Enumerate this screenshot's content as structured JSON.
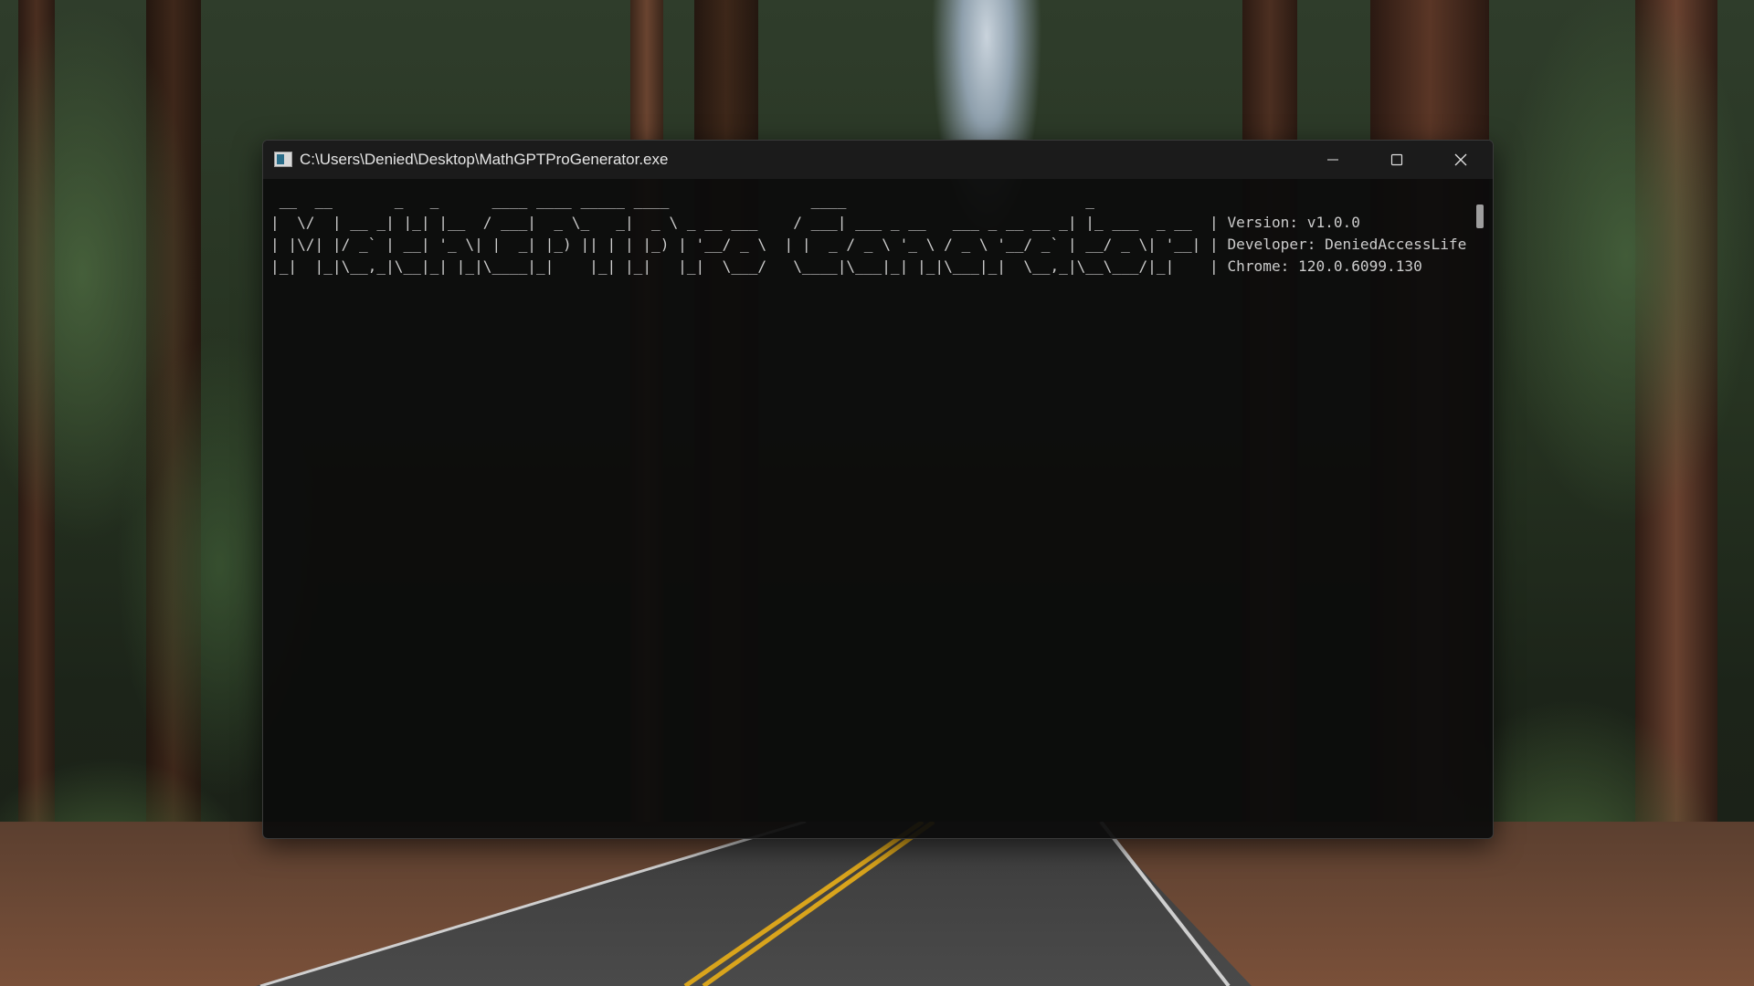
{
  "window": {
    "title": "C:\\Users\\Denied\\Desktop\\MathGPTProGenerator.exe",
    "icon": "console-app-icon"
  },
  "caption_buttons": {
    "minimize": "minimize-icon",
    "maximize": "maximize-icon",
    "close": "close-icon"
  },
  "console": {
    "lines": [
      " __  __       _   _      ____ ____ _____ ____                ____                           _             ",
      "|  \\/  | __ _| |_| |__  / ___|  _ \\_   _|  _ \\ _ __ ___    / ___| ___ _ __   ___ _ __ __ _| |_ ___  _ __  | Version: v1.0.0",
      "| |\\/| |/ _` | __| '_ \\| |  _| |_) || | | |_) | '__/ _ \\  | |  _ / _ \\ '_ \\ / _ \\ '__/ _` | __/ _ \\| '__| | Developer: DeniedAccessLife",
      "|_|  |_|\\__,_|\\__|_| |_|\\____|_|    |_| |_|   |_|  \\___/   \\____|\\___|_| |_|\\___|_|  \\__,_|\\__\\___/|_|    | Chrome: 120.0.6099.130"
    ]
  },
  "colors": {
    "console_background": "#0c0c0c",
    "console_text": "#cccccc",
    "title_bar": "#1b1b1b"
  }
}
